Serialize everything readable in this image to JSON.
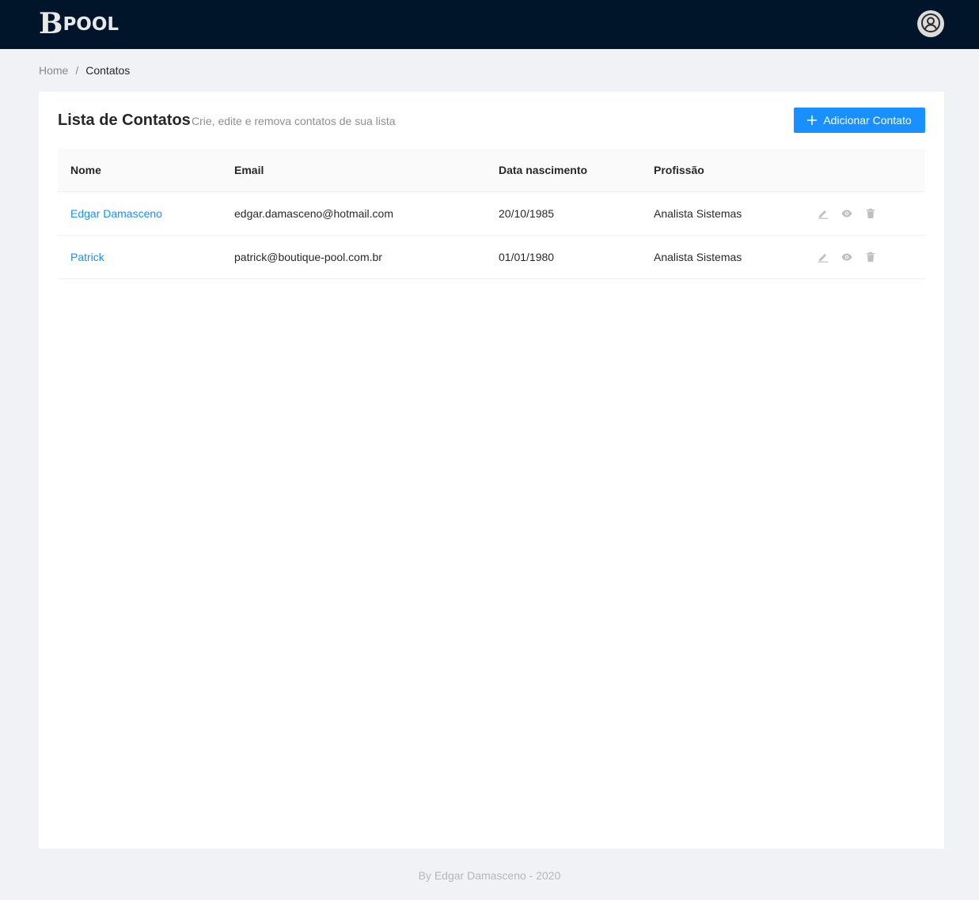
{
  "brand": {
    "logo_mark": "B",
    "logo_text": "POOL"
  },
  "header": {
    "avatar_icon": "user-icon"
  },
  "breadcrumb": {
    "home": "Home",
    "separator": "/",
    "current": "Contatos"
  },
  "page": {
    "title": "Lista de Contatos",
    "subtitle": "Crie, edite e remova contatos de sua lista",
    "add_button": {
      "icon": "plus-icon",
      "label": "Adicionar Contato"
    }
  },
  "table": {
    "columns": [
      "Nome",
      "Email",
      "Data nascimento",
      "Profissão",
      ""
    ],
    "rows": [
      {
        "name": "Edgar Damasceno",
        "email": "edgar.damasceno@hotmail.com",
        "birth": "20/10/1985",
        "profession": "Analista Sistemas"
      },
      {
        "name": "Patrick",
        "email": "patrick@boutique-pool.com.br",
        "birth": "01/01/1980",
        "profession": "Analista Sistemas"
      }
    ],
    "row_actions": [
      "edit-icon",
      "eye-icon",
      "trash-icon"
    ]
  },
  "footer": {
    "text": "By Edgar Damasceno - 2020"
  },
  "colors": {
    "header_bg": "#001529",
    "page_bg": "#f0f2f5",
    "primary": "#1890ff",
    "action_icon": "#bfbfbf"
  }
}
